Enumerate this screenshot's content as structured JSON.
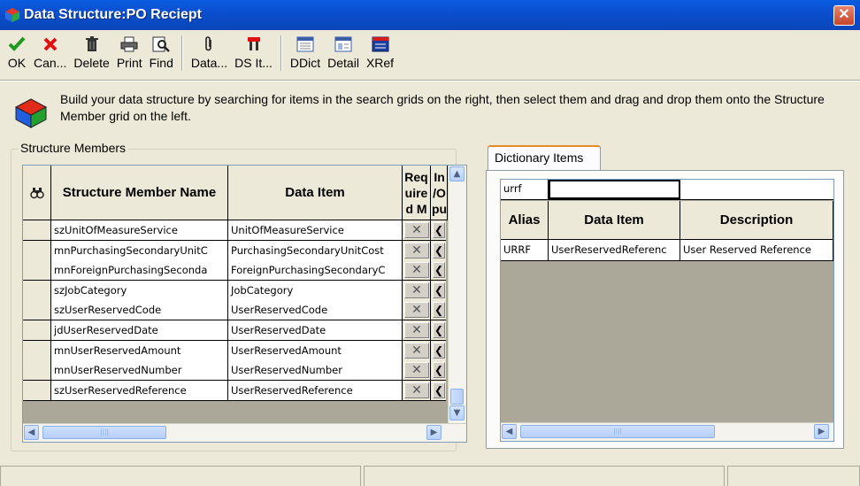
{
  "window": {
    "title": "Data Structure:PO Reciept",
    "close_symbol": "✕"
  },
  "toolbar": {
    "buttons": [
      {
        "label": "OK",
        "icon": "check-icon"
      },
      {
        "label": "Can...",
        "icon": "cancel-x-icon"
      },
      {
        "label": "Delete",
        "icon": "trash-icon"
      },
      {
        "label": "Print",
        "icon": "printer-icon"
      },
      {
        "label": "Find",
        "icon": "find-icon"
      },
      {
        "label": "Data...",
        "icon": "paperclip-icon"
      },
      {
        "label": "DS It...",
        "icon": "ds-item-icon"
      },
      {
        "label": "DDict",
        "icon": "ddict-icon"
      },
      {
        "label": "Detail",
        "icon": "detail-icon"
      },
      {
        "label": "XRef",
        "icon": "xref-icon"
      }
    ]
  },
  "instructions": "Build your data structure by searching for items in the search grids on the right, then select them and drag and drop them onto the Structure Member grid on the left.",
  "structure_members": {
    "group_label": "Structure Members",
    "columns": {
      "member_name": "Structure Member Name",
      "data_item": "Data Item",
      "required": "Req uire d M",
      "io": "In /O pu"
    },
    "rows": [
      {
        "member": "szUnitOfMeasureService",
        "item": "UnitOfMeasureService"
      },
      {
        "member": "mnPurchasingSecondaryUnitC",
        "item": "PurchasingSecondaryUnitCost"
      },
      {
        "member": "mnForeignPurchasingSeconda",
        "item": "ForeignPurchasingSecondaryC"
      },
      {
        "member": "szJobCategory",
        "item": "JobCategory"
      },
      {
        "member": "szUserReservedCode",
        "item": "UserReservedCode"
      },
      {
        "member": "jdUserReservedDate",
        "item": "UserReservedDate"
      },
      {
        "member": "mnUserReservedAmount",
        "item": "UserReservedAmount"
      },
      {
        "member": "mnUserReservedNumber",
        "item": "UserReservedNumber"
      },
      {
        "member": "szUserReservedReference",
        "item": "UserReservedReference"
      }
    ],
    "required_symbol": "✕",
    "io_symbol": "❮"
  },
  "dictionary_items": {
    "tab_label": "Dictionary Items",
    "query_alias": "urrf",
    "query_item": "",
    "query_description": "",
    "columns": {
      "alias": "Alias",
      "data_item": "Data Item",
      "description": "Description"
    },
    "rows": [
      {
        "alias": "URRF",
        "item": "UserReservedReferenc",
        "description": "User Reserved Reference"
      }
    ]
  },
  "scroll": {
    "up": "▲",
    "down": "▼",
    "left": "◀",
    "right": "▶",
    "grip": "||||"
  },
  "colors": {
    "titlebar": "#0a5ce0",
    "window_bg": "#ece9d8",
    "grid_empty": "#aca899",
    "tab_accent": "#e68b2c"
  }
}
